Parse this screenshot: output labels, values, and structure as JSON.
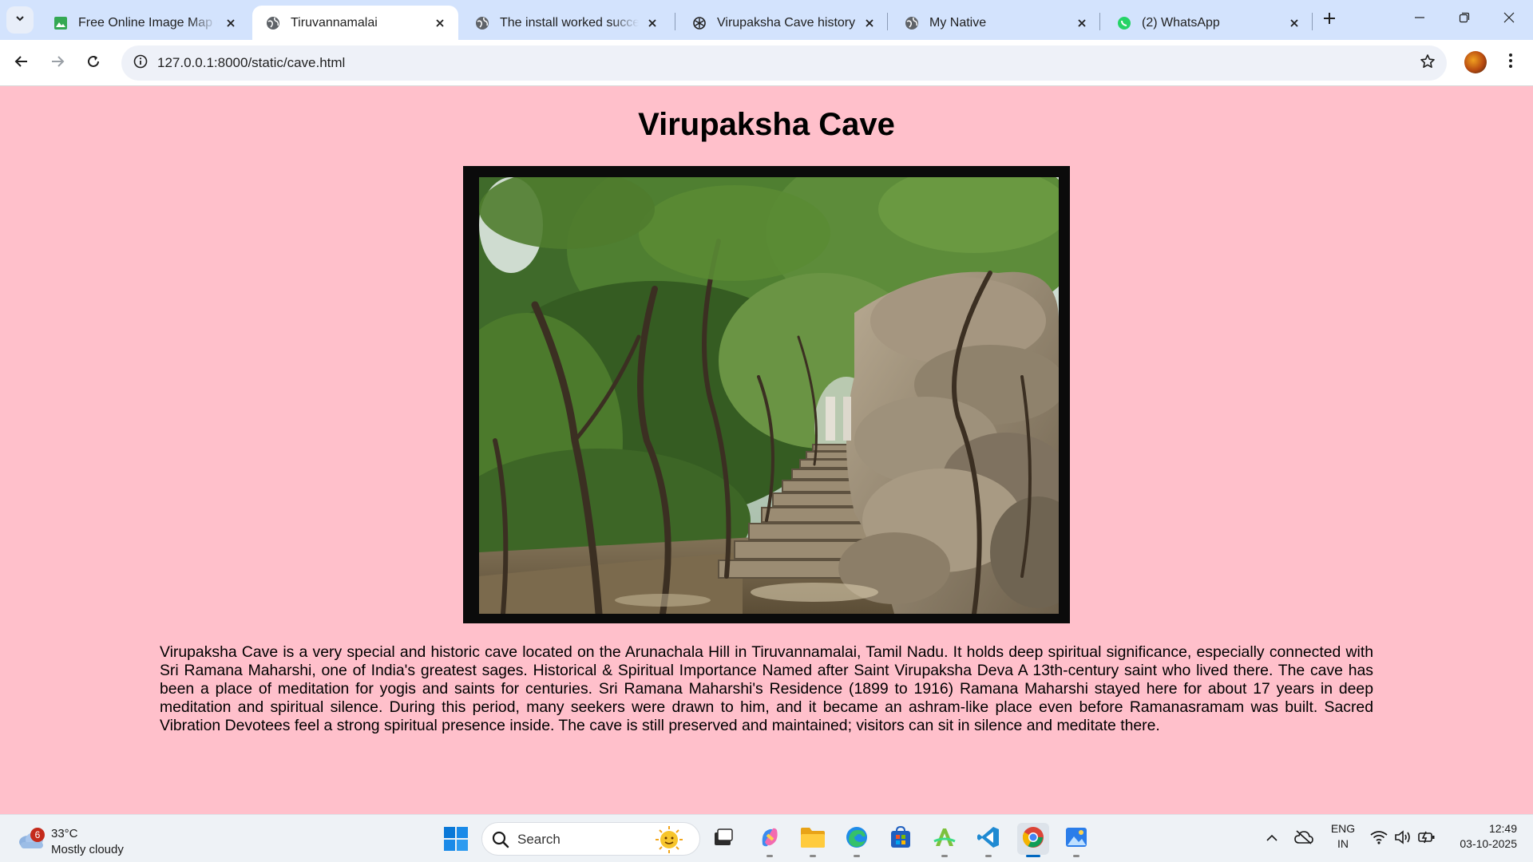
{
  "browser": {
    "tabs": [
      {
        "title": "Free Online Image Map Ge",
        "favicon": "image-icon",
        "active": false
      },
      {
        "title": "Tiruvannamalai",
        "favicon": "globe-icon",
        "active": true
      },
      {
        "title": "The install worked successfully",
        "favicon": "globe-icon",
        "active": false
      },
      {
        "title": "Virupaksha Cave history",
        "favicon": "chatgpt-icon",
        "active": false
      },
      {
        "title": "My Native",
        "favicon": "globe-icon",
        "active": false
      },
      {
        "title": "(2) WhatsApp",
        "favicon": "whatsapp-icon",
        "active": false
      }
    ],
    "url": "127.0.0.1:8000/static/cave.html"
  },
  "page": {
    "title": "Virupaksha Cave",
    "description": "Virupaksha Cave is a very special and historic cave located on the Arunachala Hill in Tiruvannamalai, Tamil Nadu. It holds deep spiritual significance, especially connected with Sri Ramana Maharshi, one of India's greatest sages. Historical & Spiritual Importance Named after Saint Virupaksha Deva A 13th-century saint who lived there. The cave has been a place of meditation for yogis and saints for centuries. Sri Ramana Maharshi's Residence (1899 to 1916) Ramana Maharshi stayed here for about 17 years in deep meditation and spiritual silence. During this period, many seekers were drawn to him, and it became an ashram-like place even before Ramanasramam was built. Sacred Vibration Devotees feel a strong spiritual presence inside. The cave is still preserved and maintained; visitors can sit in silence and meditate there."
  },
  "taskbar": {
    "weather": {
      "badge": "6",
      "temperature": "33°C",
      "condition": "Mostly cloudy"
    },
    "search_label": "Search",
    "language": {
      "line1": "ENG",
      "line2": "IN"
    },
    "time": "12:49",
    "date": "03-10-2025"
  },
  "colors": {
    "page_background": "#ffc0cb",
    "tab_strip": "#d3e3fd",
    "photo_frame": "#0b0b0b"
  }
}
